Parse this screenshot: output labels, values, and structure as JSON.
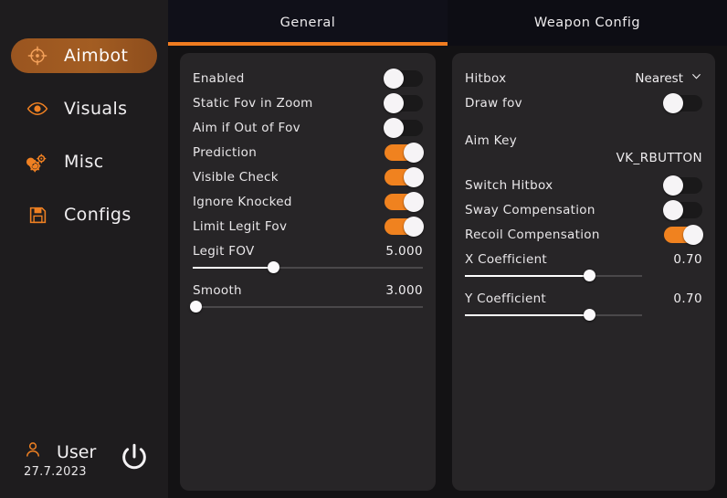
{
  "sidebar": {
    "items": [
      {
        "label": "Aimbot",
        "icon": "crosshair-icon",
        "active": true
      },
      {
        "label": "Visuals",
        "icon": "eye-icon",
        "active": false
      },
      {
        "label": "Misc",
        "icon": "gears-icon",
        "active": false
      },
      {
        "label": "Configs",
        "icon": "floppy-disk-icon",
        "active": false
      }
    ],
    "footer": {
      "user_icon": "user-icon",
      "user_name": "User",
      "date": "27.7.2023",
      "power_icon": "power-icon"
    }
  },
  "tabs": [
    {
      "label": "General",
      "active": true
    },
    {
      "label": "Weapon Config",
      "active": false
    }
  ],
  "left_panel": {
    "toggles": [
      {
        "label": "Enabled",
        "on": false
      },
      {
        "label": "Static Fov in Zoom",
        "on": false
      },
      {
        "label": "Aim if Out of Fov",
        "on": false
      },
      {
        "label": "Prediction",
        "on": true
      },
      {
        "label": "Visible Check",
        "on": true
      },
      {
        "label": "Ignore Knocked",
        "on": true
      },
      {
        "label": "Limit Legit Fov",
        "on": true
      }
    ],
    "sliders": [
      {
        "label": "Legit FOV",
        "value": "5.000",
        "percent": 35
      },
      {
        "label": "Smooth",
        "value": "3.000",
        "percent": 1
      }
    ]
  },
  "right_panel": {
    "hitbox": {
      "label": "Hitbox",
      "value": "Nearest",
      "icon": "chevron-down-icon"
    },
    "draw_fov": {
      "label": "Draw fov",
      "on": false
    },
    "aim_key": {
      "label": "Aim Key",
      "value": "VK_RBUTTON"
    },
    "toggles": [
      {
        "label": "Switch Hitbox",
        "on": false
      },
      {
        "label": "Sway Compensation",
        "on": false
      },
      {
        "label": "Recoil Compensation",
        "on": true
      }
    ],
    "sliders": [
      {
        "label": "X Coefficient",
        "value": "0.70",
        "percent": 70
      },
      {
        "label": "Y Coefficient",
        "value": "0.70",
        "percent": 70
      }
    ]
  },
  "colors": {
    "accent": "#f0821f",
    "accent_muted": "#9a5520",
    "panel_bg": "#272527",
    "sidebar_bg": "#1e1c1e",
    "tabbar_bg": "#0d0d14",
    "text": "#e9e7e9"
  }
}
